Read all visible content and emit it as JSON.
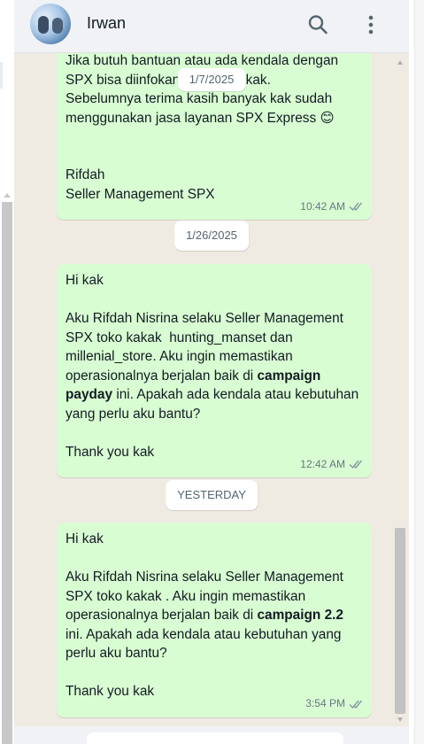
{
  "header": {
    "contact_name": "Irwan",
    "avatar_icon": "profile-photo",
    "search_icon": "search-icon",
    "menu_icon": "more-vertical-icon"
  },
  "messages": [
    {
      "lines": [
        [
          {
            "t": "Jika butuh bantuan atau ada kendala dengan"
          }
        ],
        [
          {
            "t": "SPX bisa diinfokan ke aku ya kak."
          }
        ],
        [
          {
            "t": "Sebelumnya terima kasih banyak kak sudah"
          }
        ],
        [
          {
            "t": "menggunakan jasa layanan SPX Express 😊"
          }
        ],
        [
          {
            "t": ""
          }
        ],
        [
          {
            "t": ""
          }
        ],
        [
          {
            "t": "Rifdah"
          }
        ],
        [
          {
            "t": "Seller Management SPX"
          }
        ]
      ],
      "time": "10:42 AM",
      "status": "read"
    },
    {
      "lines": [
        [
          {
            "t": "Hi kak"
          }
        ],
        [
          {
            "t": ""
          }
        ],
        [
          {
            "t": "Aku Rifdah Nisrina selaku Seller Management"
          }
        ],
        [
          {
            "t": "SPX toko kakak  hunting_manset dan"
          }
        ],
        [
          {
            "t": "millenial_store. Aku ingin memastikan"
          }
        ],
        [
          {
            "t": "operasionalnya berjalan baik di "
          },
          {
            "t": "campaign",
            "b": true
          }
        ],
        [
          {
            "t": "payday",
            "b": true
          },
          {
            "t": " ini. Apakah ada kendala atau kebutuhan"
          }
        ],
        [
          {
            "t": "yang perlu aku bantu?"
          }
        ],
        [
          {
            "t": ""
          }
        ],
        [
          {
            "t": "Thank you kak"
          }
        ]
      ],
      "time": "12:42 AM",
      "status": "read"
    },
    {
      "lines": [
        [
          {
            "t": "Hi kak"
          }
        ],
        [
          {
            "t": ""
          }
        ],
        [
          {
            "t": "Aku Rifdah Nisrina selaku Seller Management"
          }
        ],
        [
          {
            "t": "SPX toko kakak . Aku ingin memastikan"
          }
        ],
        [
          {
            "t": "operasionalnya berjalan baik di "
          },
          {
            "t": "campaign 2.2",
            "b": true
          }
        ],
        [
          {
            "t": "ini. Apakah ada kendala atau kebutuhan yang"
          }
        ],
        [
          {
            "t": "perlu aku bantu?"
          }
        ],
        [
          {
            "t": ""
          }
        ],
        [
          {
            "t": "Thank you kak"
          }
        ]
      ],
      "time": "3:54 PM",
      "status": "read"
    }
  ],
  "date_chips": {
    "sticky": "1/7/2025",
    "chip1": "1/26/2025",
    "chip2": "YESTERDAY"
  },
  "colors": {
    "outgoing_bubble": "#d9fdd3",
    "chat_background": "#efeae2",
    "read_tick": "#8696a0"
  }
}
